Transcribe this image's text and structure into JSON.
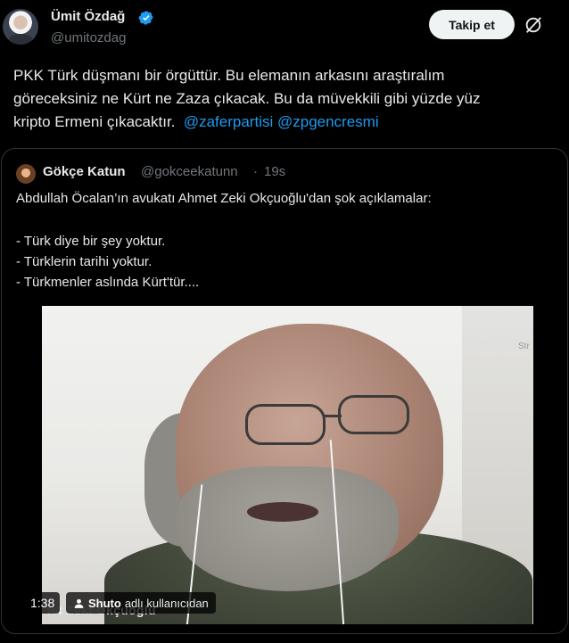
{
  "author": {
    "name": "Ümit Özdağ",
    "handle": "@umitozdag",
    "follow_label": "Takip et",
    "avatar_icon": "user-avatar",
    "verified_icon": "verified-badge-icon",
    "grok_icon": "grok-icon"
  },
  "tweet": {
    "line1": "PKK Türk düşmanı bir örgüttür. Bu elemanın arkasını araştıralım",
    "line2": "göreceksiniz ne Kürt ne Zaza çıkacak. Bu da müvekkili gibi yüzde yüz",
    "line3_text": "kripto Ermeni çıkacaktır.",
    "mention1": "@zaferpartisi",
    "mention2": "@zpgencresmi"
  },
  "quote": {
    "name": "Gökçe Katun",
    "handle": "@gokceekatunn",
    "separator": "·",
    "time": "19s",
    "line1": "Abdullah Öcalan’ın avukatı Ahmet Zeki Okçuoğlu'dan şok açıklamalar:",
    "line2": "- Türk diye bir şey yoktur.",
    "line3": "- Türklerin tarihi yoktur.",
    "line4": "- Türkmenler aslında Kürt'tür...."
  },
  "media": {
    "duration": "1:38",
    "attribution_name": "Shuto",
    "attribution_suffix": "adlı kullanıcıdan",
    "overlay_caption": "let Zeki Okçuoğlu",
    "stream_label": "Str"
  },
  "colors": {
    "background": "#000000",
    "text": "#e7e9ea",
    "muted": "#71767b",
    "link": "#1d9bf0",
    "verified": "#1d9bf0",
    "border": "#2f3336",
    "button_bg": "#eff3f4"
  }
}
